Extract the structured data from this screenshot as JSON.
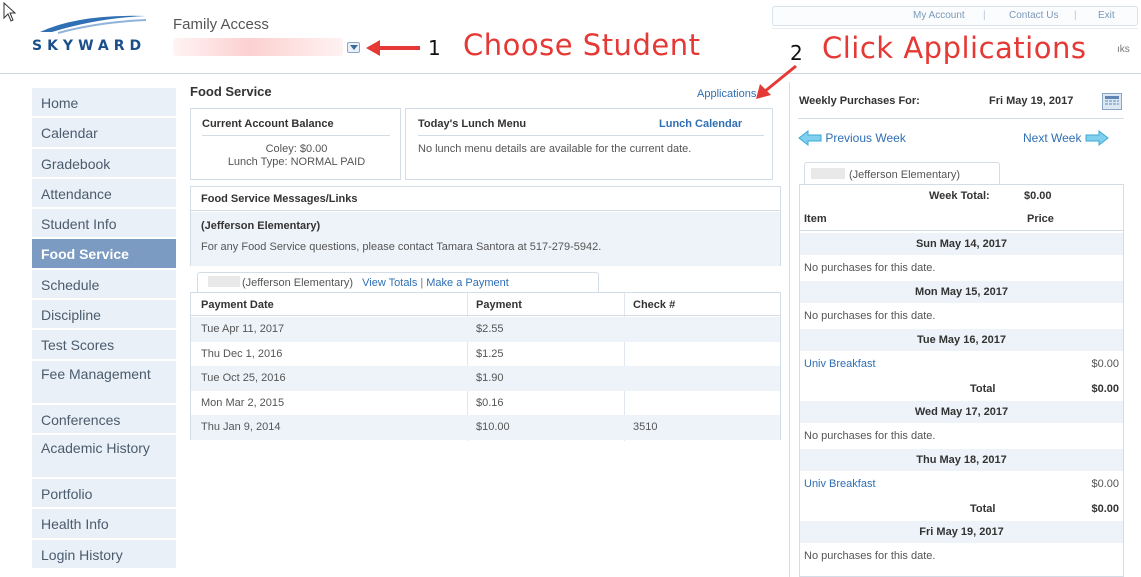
{
  "header": {
    "app_title": "Family Access",
    "logo_text": "SKYWARD",
    "top_links": [
      "My Account",
      "Contact Us",
      "Exit"
    ],
    "links_tail": "ıks"
  },
  "annotations": [
    {
      "number": "1",
      "text": "Choose Student"
    },
    {
      "number": "2",
      "text": "Click Applications"
    }
  ],
  "nav": {
    "items": [
      "Home",
      "Calendar",
      "Gradebook",
      "Attendance",
      "Student Info",
      "Food Service",
      "Schedule",
      "Discipline",
      "Test Scores",
      "Fee Management",
      "Conferences",
      "Academic History",
      "Portfolio",
      "Health Info",
      "Login History"
    ],
    "active": "Food Service"
  },
  "food_service": {
    "title": "Food Service",
    "applications_link": "Applications",
    "balance": {
      "heading": "Current Account Balance",
      "line1": "Coley:  $0.00",
      "line2": "Lunch Type:  NORMAL PAID"
    },
    "lunch": {
      "heading": "Today's Lunch Menu",
      "calendar_link": "Lunch Calendar",
      "message": "No lunch menu details are available for the current date."
    },
    "messages": {
      "heading": "Food Service Messages/Links",
      "school": "(Jefferson Elementary)",
      "text": "For any Food Service questions, please contact Tamara Santora at 517-279-5942."
    },
    "payments": {
      "tab_school": "(Jefferson Elementary)",
      "view_totals": "View Totals",
      "separator": "|",
      "make_payment": "Make a Payment",
      "columns": [
        "Payment Date",
        "Payment",
        "Check #"
      ],
      "rows": [
        [
          "Tue Apr 11, 2017",
          "$2.55",
          ""
        ],
        [
          "Thu Dec 1, 2016",
          "$1.25",
          ""
        ],
        [
          "Tue Oct 25, 2016",
          "$1.90",
          ""
        ],
        [
          "Mon Mar 2, 2015",
          "$0.16",
          ""
        ],
        [
          "Thu Jan 9, 2014",
          "$10.00",
          "3510"
        ]
      ]
    }
  },
  "weekly": {
    "label": "Weekly Purchases For:",
    "date": "Fri May 19, 2017",
    "prev_week": "Previous Week",
    "next_week": "Next Week",
    "school_tab": "(Jefferson Elementary)",
    "week_total_label": "Week Total:",
    "week_total_value": "$0.00",
    "col_item": "Item",
    "col_price": "Price",
    "days": [
      {
        "date": "Sun May 14, 2017",
        "none": "No purchases for this date."
      },
      {
        "date": "Mon May 15, 2017",
        "none": "No purchases for this date."
      },
      {
        "date": "Tue May 16, 2017",
        "item": "Univ Breakfast",
        "price": "$0.00",
        "total_label": "Total",
        "total": "$0.00"
      },
      {
        "date": "Wed May 17, 2017",
        "none": "No purchases for this date."
      },
      {
        "date": "Thu May 18, 2017",
        "item": "Univ Breakfast",
        "price": "$0.00",
        "total_label": "Total",
        "total": "$0.00"
      },
      {
        "date": "Fri May 19, 2017",
        "none": "No purchases for this date."
      }
    ]
  },
  "colors": {
    "nav_active": "#7c9bc3",
    "nav_bg": "#eaf0f7",
    "link": "#2f6fb3",
    "annotation": "#e53935"
  }
}
